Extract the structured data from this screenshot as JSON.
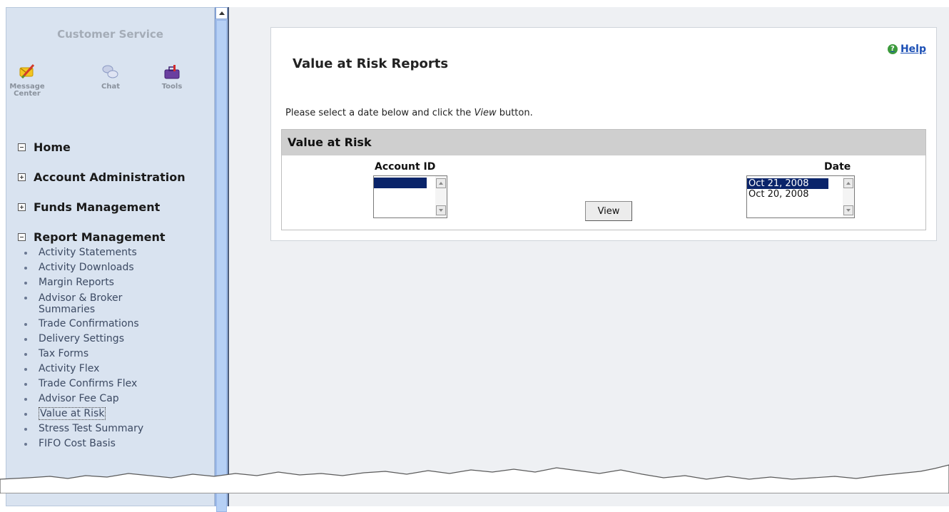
{
  "sidebar": {
    "customer_service_title": "Customer Service",
    "icons": [
      {
        "name": "message-center",
        "label_line1": "Message",
        "label_line2": "Center"
      },
      {
        "name": "chat",
        "label_line1": "Chat",
        "label_line2": ""
      },
      {
        "name": "tools",
        "label_line1": "Tools",
        "label_line2": ""
      }
    ],
    "sections": [
      {
        "label": "Home",
        "state": "collapsed-minus"
      },
      {
        "label": "Account Administration",
        "state": "expandable-plus"
      },
      {
        "label": "Funds Management",
        "state": "expandable-plus"
      },
      {
        "label": "Report Management",
        "state": "expanded-minus"
      }
    ],
    "report_items": [
      {
        "label": "Activity Statements"
      },
      {
        "label": "Activity Downloads"
      },
      {
        "label": "Margin Reports"
      },
      {
        "label_line1": "Advisor & Broker",
        "label_line2": "Summaries"
      },
      {
        "label": "Trade Confirmations"
      },
      {
        "label": "Delivery Settings"
      },
      {
        "label": "Tax Forms"
      },
      {
        "label": "Activity Flex"
      },
      {
        "label": "Trade Confirms Flex"
      },
      {
        "label": "Advisor Fee Cap"
      },
      {
        "label": "Value at Risk",
        "active": true
      },
      {
        "label": "Stress Test Summary"
      },
      {
        "label": "FIFO Cost Basis"
      }
    ]
  },
  "main": {
    "title": "Value at Risk Reports",
    "help_label": "Help",
    "instructions_before": "Please select a date below and click the ",
    "instructions_em": "View",
    "instructions_after": " button.",
    "section_header": "Value at Risk",
    "account_id_label": "Account ID",
    "date_label": "Date",
    "account_options": [
      {
        "value": "",
        "selected": true,
        "redacted": true
      }
    ],
    "date_options": [
      {
        "value": "Oct 21, 2008",
        "selected": true
      },
      {
        "value": "Oct 20, 2008",
        "selected": false
      }
    ],
    "view_button_label": "View"
  },
  "colors": {
    "sidebar_bg": "#d9e3f0",
    "selection": "#0a246a",
    "help_link": "#1b4fb5",
    "section_header_bg": "#cfcfcf"
  }
}
